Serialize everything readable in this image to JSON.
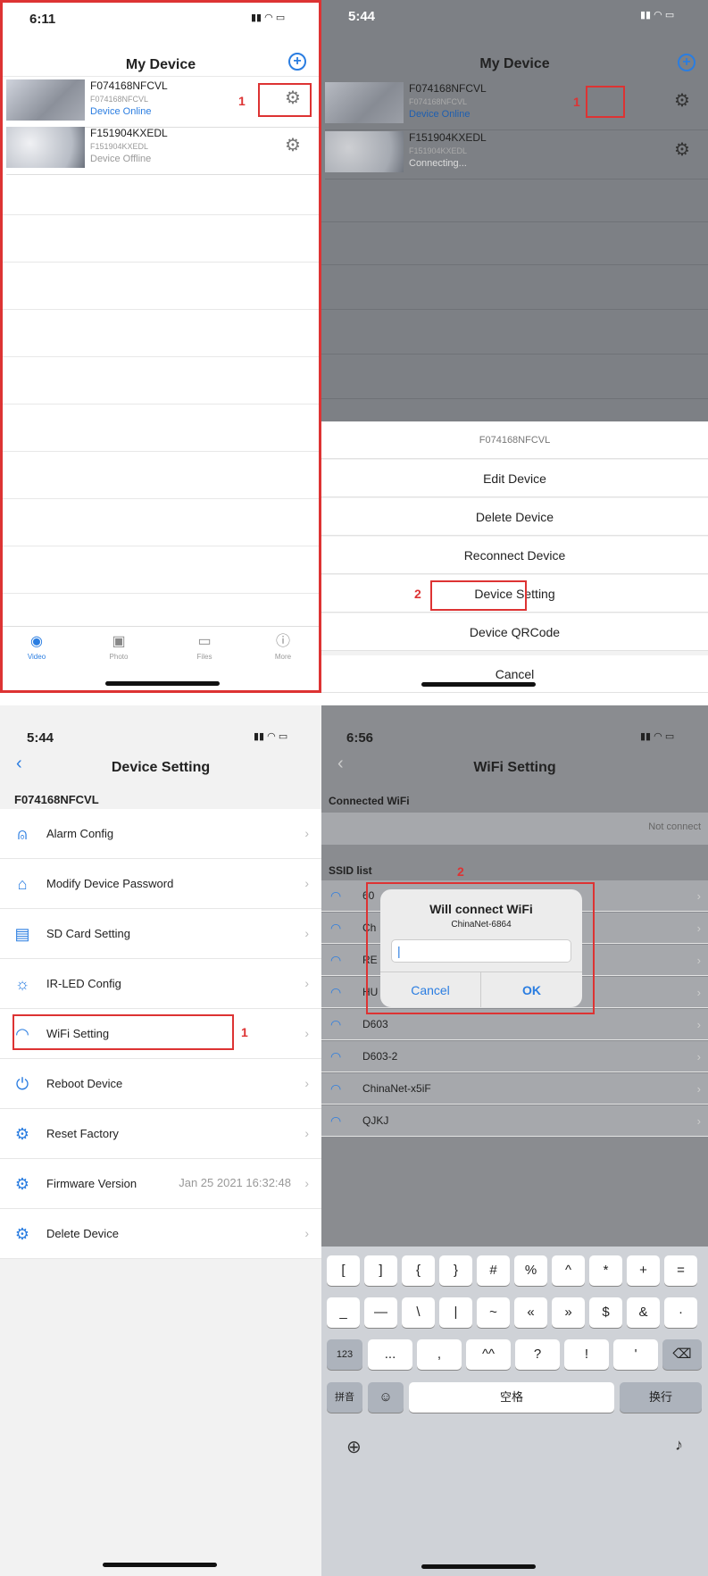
{
  "panel1": {
    "time": "6:11",
    "title": "My Device",
    "devices": [
      {
        "name": "F074168NFCVL",
        "sub": "F074168NFCVL",
        "status": "Device Online"
      },
      {
        "name": "F151904KXEDL",
        "sub": "F151904KXEDL",
        "status": "Device Offline"
      }
    ],
    "annotation": "1",
    "tabs": [
      "Video",
      "Photo",
      "Files",
      "More"
    ]
  },
  "panel2": {
    "time": "5:44",
    "title": "My Device",
    "devices": [
      {
        "name": "F074168NFCVL",
        "sub": "F074168NFCVL",
        "status": "Device Online"
      },
      {
        "name": "F151904KXEDL",
        "sub": "F151904KXEDL",
        "status": "Connecting..."
      }
    ],
    "annotation1": "1",
    "annotation2": "2",
    "sheet_title": "F074168NFCVL",
    "sheet_items": [
      "Edit Device",
      "Delete Device",
      "Reconnect Device",
      "Device Setting",
      "Device QRCode"
    ],
    "cancel": "Cancel"
  },
  "panel3": {
    "time": "5:44",
    "title": "Device Setting",
    "device": "F074168NFCVL",
    "annotation": "1",
    "rows": [
      {
        "label": "Alarm Config",
        "value": ""
      },
      {
        "label": "Modify Device Password",
        "value": ""
      },
      {
        "label": "SD Card Setting",
        "value": ""
      },
      {
        "label": "IR-LED Config",
        "value": ""
      },
      {
        "label": "WiFi Setting",
        "value": ""
      },
      {
        "label": "Reboot Device",
        "value": ""
      },
      {
        "label": "Reset Factory",
        "value": ""
      },
      {
        "label": "Firmware Version",
        "value": "Jan 25 2021 16:32:48"
      },
      {
        "label": "Delete Device",
        "value": ""
      }
    ]
  },
  "panel4": {
    "time": "6:56",
    "title": "WiFi Setting",
    "connected_header": "Connected WiFi",
    "not_connect": "Not connect",
    "ssid_header": "SSID list",
    "annotation": "2",
    "ssids": [
      "60",
      "Ch",
      "RE",
      "HU",
      "D603",
      "D603-2",
      "ChinaNet-x5iF",
      "QJKJ"
    ],
    "dialog": {
      "title": "Will connect WiFi",
      "subtitle": "ChinaNet-6864",
      "input": "|",
      "cancel": "Cancel",
      "ok": "OK"
    },
    "keyboard": {
      "row1": [
        "[",
        "]",
        "{",
        "}",
        "#",
        "%",
        "^",
        "*",
        "+",
        "="
      ],
      "row2": [
        "_",
        "—",
        "\\",
        "|",
        "~",
        "«",
        "»",
        "$",
        "&",
        "·"
      ],
      "row3": [
        "...",
        ",",
        "^^",
        "?",
        "!",
        "'"
      ],
      "key123": "123",
      "pinyin": "拼音",
      "space": "空格",
      "enter": "换行"
    }
  },
  "colors": {
    "accent": "#2a7de1",
    "red": "#d33"
  }
}
